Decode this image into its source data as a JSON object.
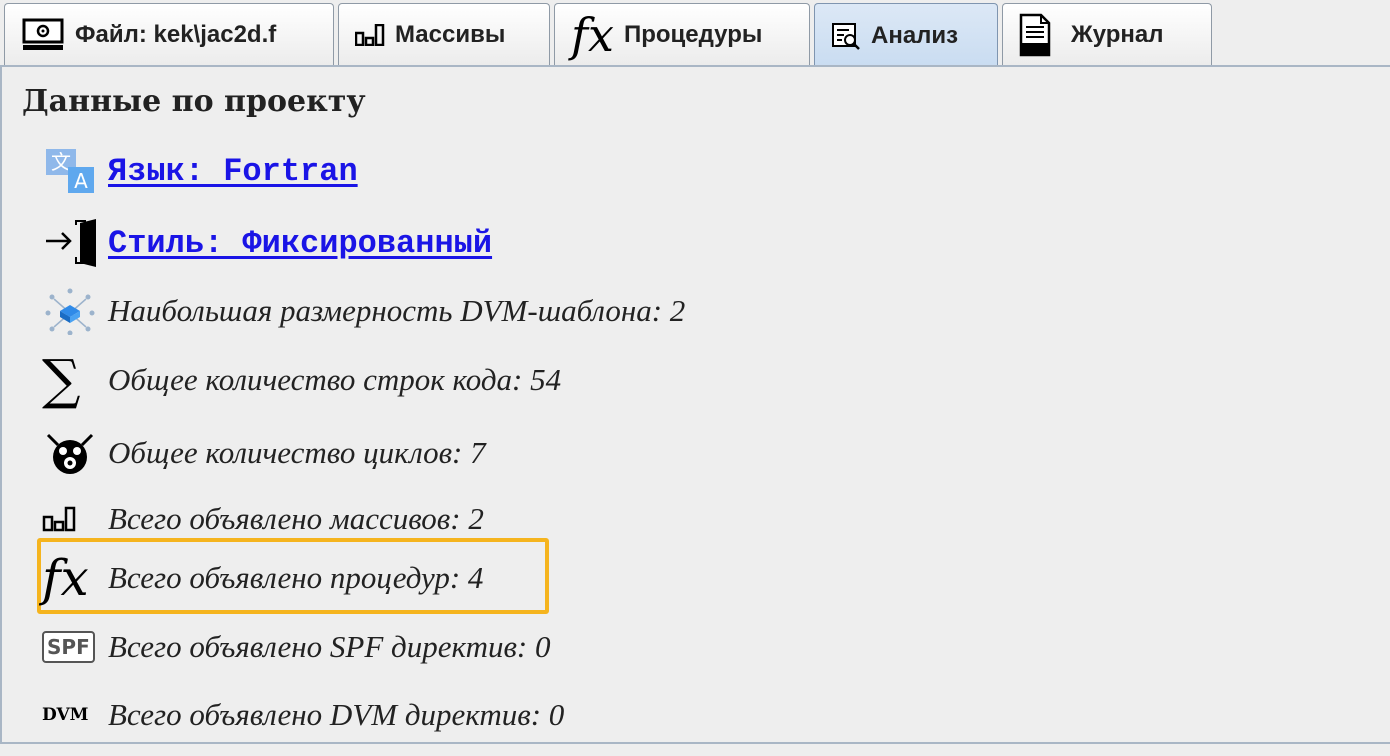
{
  "tabs": [
    {
      "label": "Файл: kek\\jac2d.f",
      "icon": "file-monitor-icon",
      "active": false
    },
    {
      "label": "Массивы",
      "icon": "arrays-icon",
      "active": false
    },
    {
      "label": "Процедуры",
      "icon": "fx-icon",
      "icon_text": "fx",
      "active": false
    },
    {
      "label": "Анализ",
      "icon": "analysis-icon",
      "active": true
    },
    {
      "label": "Журнал",
      "icon": "log-icon",
      "icon_text": "LOG",
      "active": false
    }
  ],
  "section_title": "Данные по проекту",
  "items": [
    {
      "kind": "link",
      "icon": "translate-icon",
      "text": "Язык: Fortran"
    },
    {
      "kind": "link",
      "icon": "enter-door-icon",
      "text": "Стиль: Фиксированный"
    },
    {
      "kind": "info",
      "icon": "distribution-icon",
      "text": "Наибольшая размерность DVM-шаблона: 2"
    },
    {
      "kind": "info",
      "icon": "sigma-icon",
      "icon_text": "∑",
      "text": "Общее количество строк кода: 54"
    },
    {
      "kind": "info",
      "icon": "loop-cat-icon",
      "text": "Общее количество циклов: 7"
    },
    {
      "kind": "info",
      "icon": "arrays-icon",
      "text": "Всего объявлено массивов: 2"
    },
    {
      "kind": "info",
      "icon": "fx-icon",
      "icon_text": "fx",
      "text": "Всего объявлено процедур: 4",
      "highlighted": true
    },
    {
      "kind": "info",
      "icon": "spf-icon",
      "icon_text": "SPF",
      "text": "Всего объявлено SPF директив: 0"
    },
    {
      "kind": "info",
      "icon": "dvm-icon",
      "icon_text": "DVM",
      "text": "Всего объявлено DVM директив: 0"
    }
  ],
  "colors": {
    "highlight": "#f5b41e",
    "link": "#1a14e6",
    "active_tab": "#c9dcf1"
  }
}
